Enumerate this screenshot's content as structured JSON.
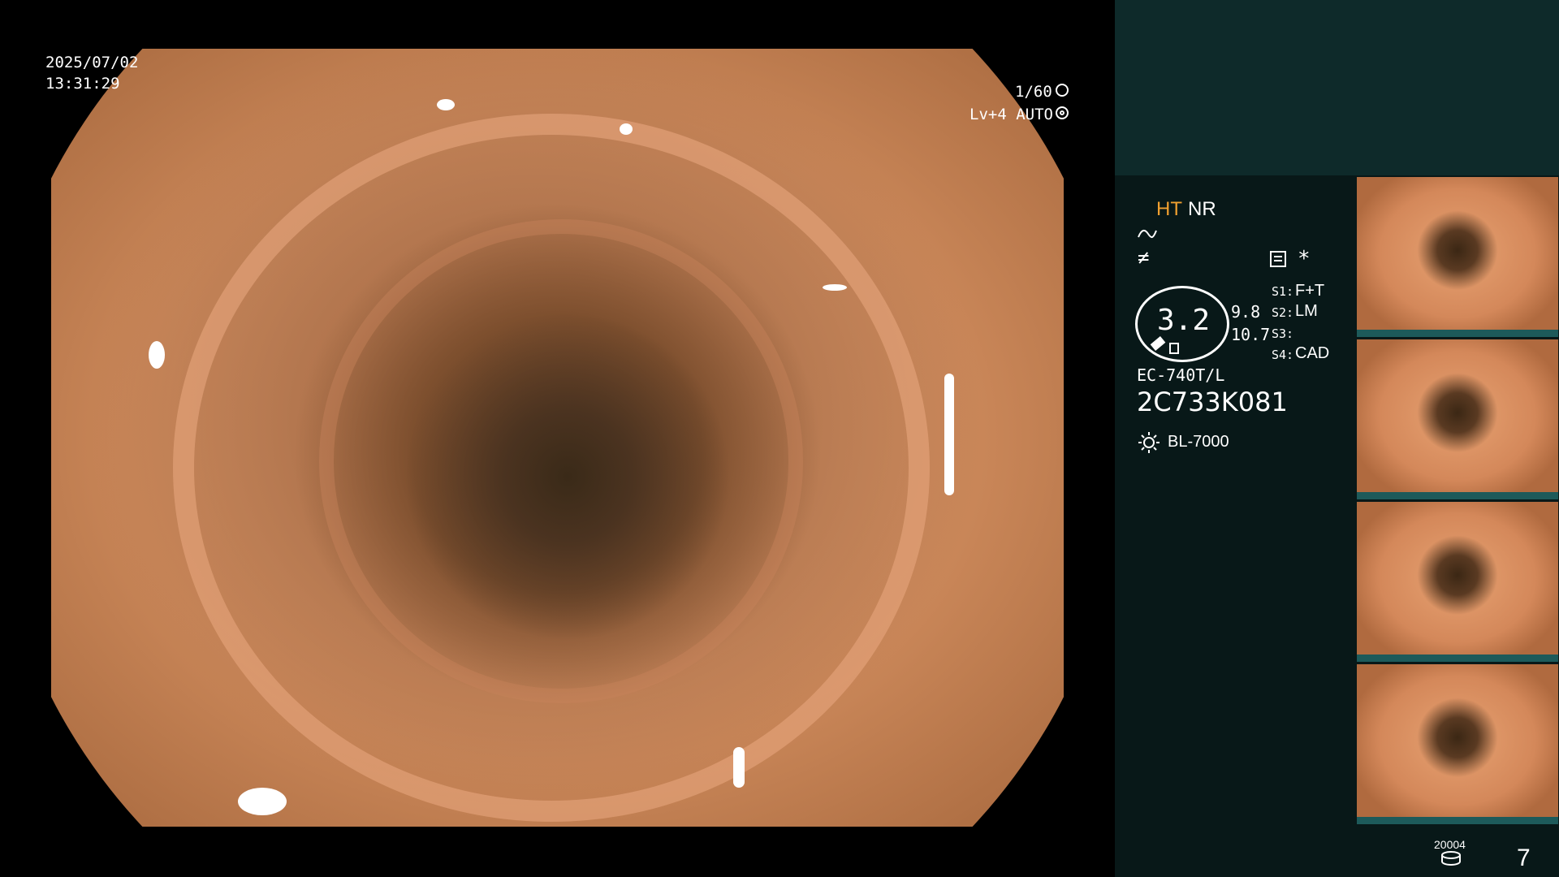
{
  "datetime": {
    "date": "2025/07/02",
    "time": "13:31:29"
  },
  "scope_overlay": {
    "shutter": "1/60",
    "shutter_icon": "aperture-icon",
    "level": "Lv+4 AUTO",
    "level_icon": "auto-exposure-icon"
  },
  "panel": {
    "mode_ht": "HT",
    "mode_nr": "NR",
    "icon_a": "curve-icon",
    "icon_b": "not-equal-icon",
    "settings_icon": "settings-icon",
    "asterisk": "*",
    "zoom_value": "3.2",
    "zoom_sub_1": "9.8",
    "zoom_sub_2": "10.7",
    "s1_key": "S1:",
    "s1_val": "F+T",
    "s2_key": "S2:",
    "s2_val": "LM",
    "s3_key": "S3:",
    "s4_key": "S4:",
    "s4_val": "CAD",
    "scope_model": "EC-740T/L",
    "serial": "2C733K081",
    "light_icon": "sun-icon",
    "light_source": "BL-7000",
    "footer_code": "20004",
    "footer_count": "7",
    "footer_icon": "storage-icon"
  },
  "colors": {
    "panel_bg": "#081818",
    "panel_top": "#0e2a2a",
    "accent_orange": "#f0a030"
  }
}
